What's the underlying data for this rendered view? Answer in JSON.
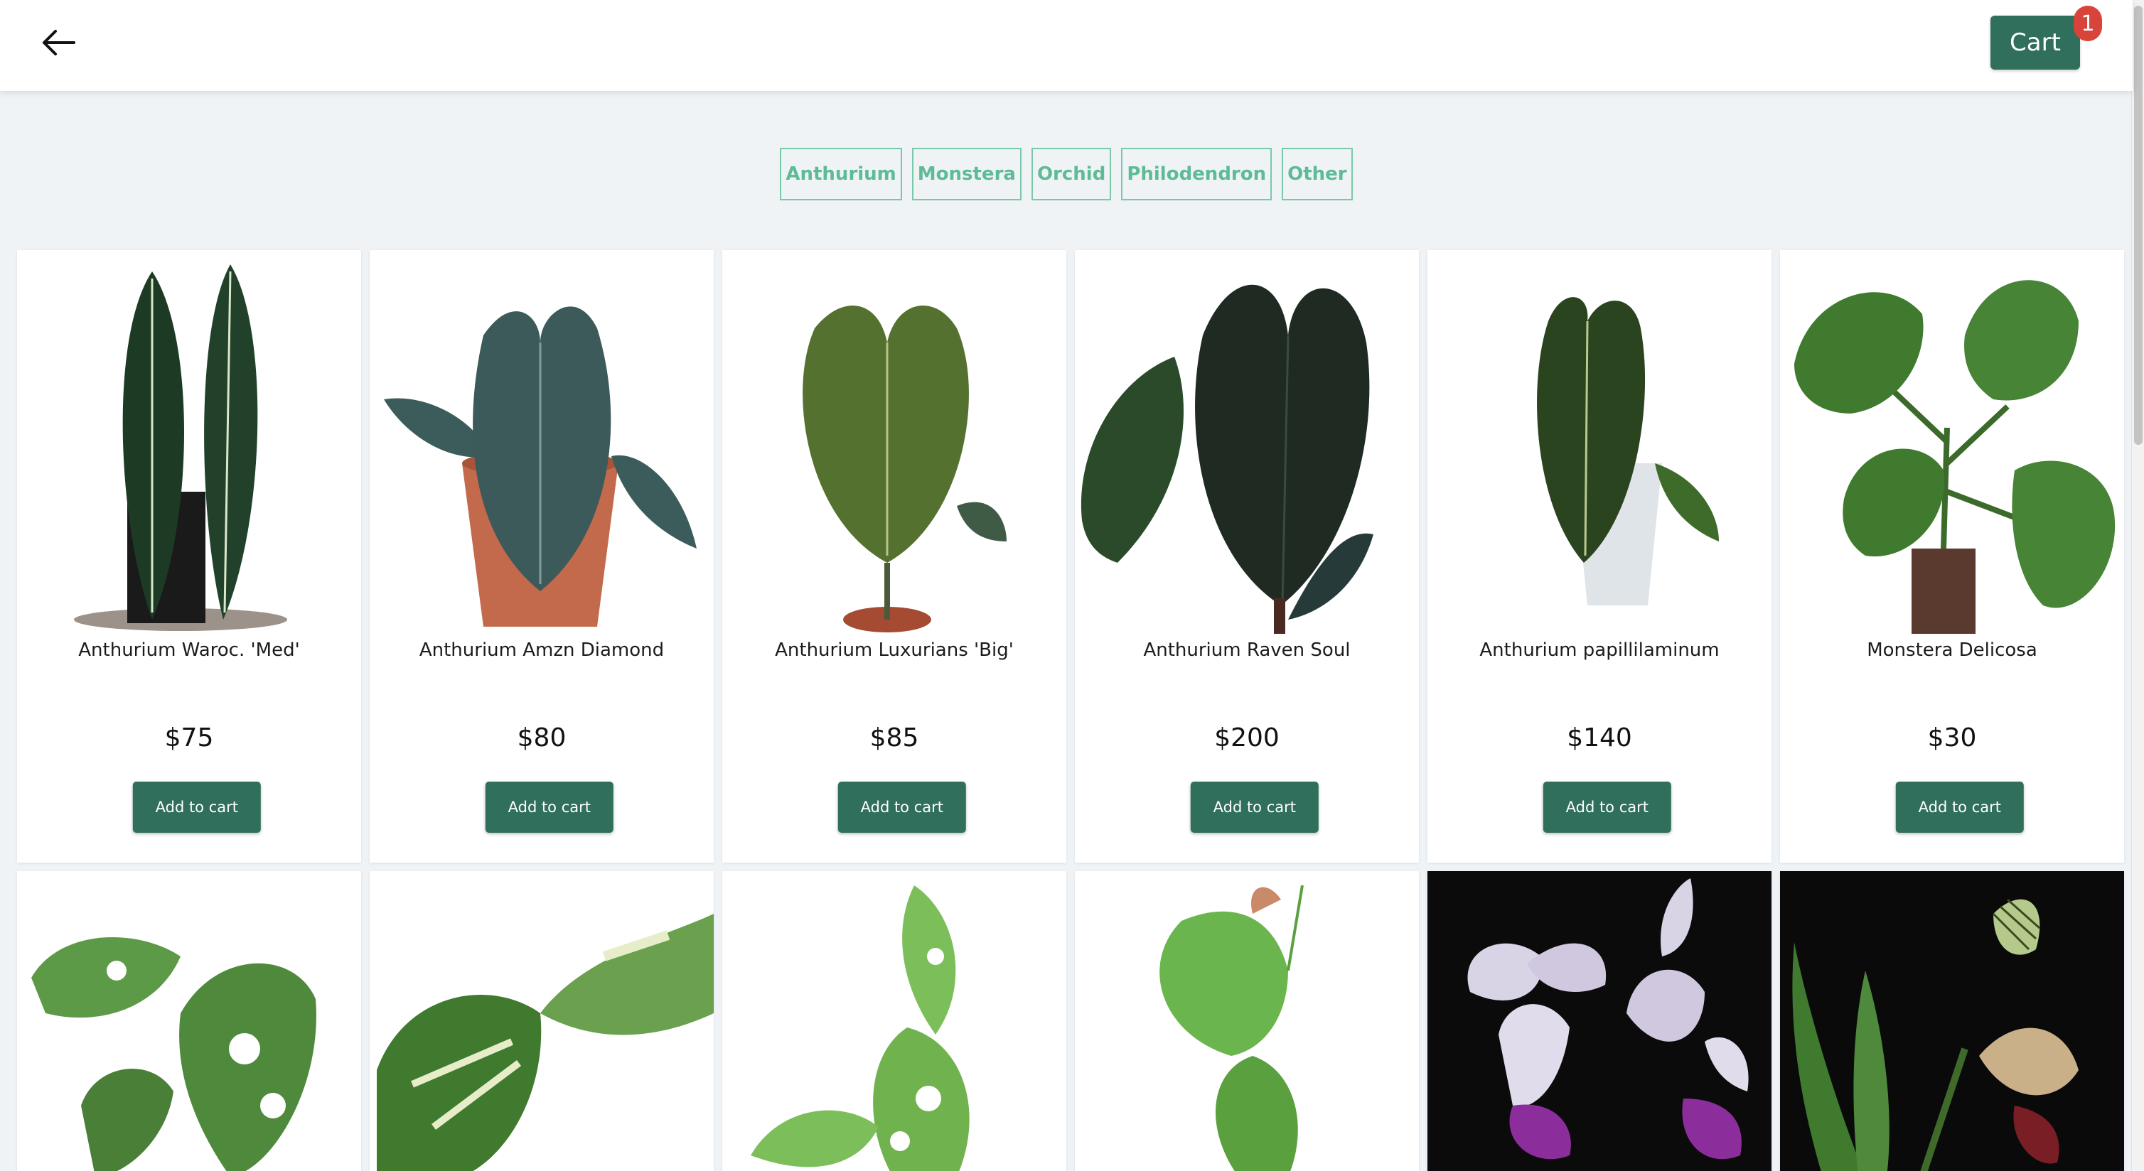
{
  "header": {
    "back_icon": "arrow-left-icon",
    "cart_label": "Cart",
    "cart_count": "1",
    "accent": "#2f6f5c",
    "badge_color": "#d9443a"
  },
  "filters": [
    "Anthurium",
    "Monstera",
    "Orchid",
    "Philodendron",
    "Other"
  ],
  "products": [
    {
      "name": "Anthurium Waroc. 'Med'",
      "price": "$75",
      "button": "Add to cart"
    },
    {
      "name": "Anthurium Amzn Diamond",
      "price": "$80",
      "button": "Add to cart"
    },
    {
      "name": "Anthurium Luxurians 'Big'",
      "price": "$85",
      "button": "Add to cart"
    },
    {
      "name": "Anthurium Raven Soul",
      "price": "$200",
      "button": "Add to cart"
    },
    {
      "name": "Anthurium papillilaminum",
      "price": "$140",
      "button": "Add to cart"
    },
    {
      "name": "Monstera Delicosa",
      "price": "$30",
      "button": "Add to cart"
    }
  ]
}
